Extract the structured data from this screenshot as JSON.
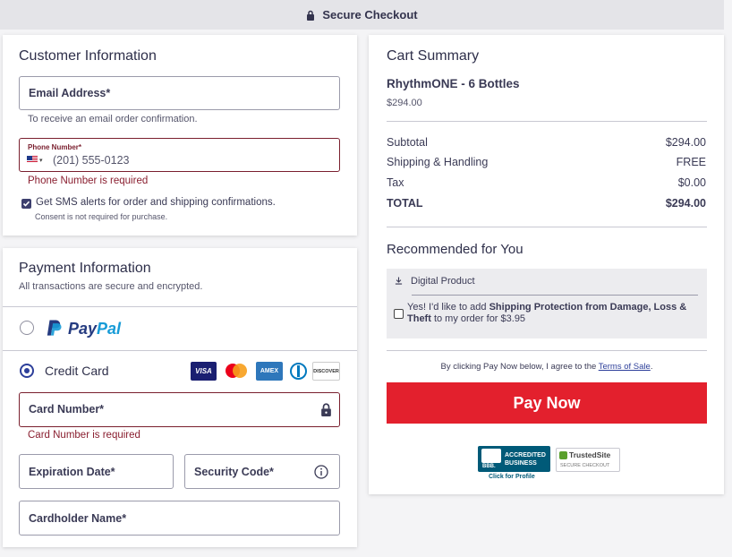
{
  "topbar": {
    "title": "Secure Checkout"
  },
  "customer": {
    "title": "Customer Information",
    "email": {
      "label": "Email Address*",
      "hint": "To receive an email order confirmation."
    },
    "phone": {
      "label": "Phone Number*",
      "placeholder": "(201) 555-0123",
      "country_flag": "us-flag-icon",
      "error": "Phone Number is required"
    },
    "sms": {
      "label": "Get SMS alerts for order and shipping confirmations.",
      "subtext": "Consent is not required for purchase.",
      "checked": true
    }
  },
  "payment": {
    "title": "Payment Information",
    "subtitle": "All transactions are secure and encrypted.",
    "paypal": {
      "label_pay": "Pay",
      "label_pal": "Pal"
    },
    "credit": {
      "label": "Credit Card",
      "logos": [
        "VISA",
        "mastercard",
        "AMEX",
        "diners",
        "DISCOVER"
      ]
    },
    "card_number": {
      "label": "Card Number*",
      "error": "Card Number is required"
    },
    "expiration": {
      "label": "Expiration Date*"
    },
    "security": {
      "label": "Security Code*"
    },
    "cardholder": {
      "label": "Cardholder Name*"
    }
  },
  "cart": {
    "title": "Cart Summary",
    "product": {
      "name": "RhythmONE - 6 Bottles",
      "price": "$294.00"
    },
    "rows": [
      {
        "label": "Subtotal",
        "value": "$294.00"
      },
      {
        "label": "Shipping & Handling",
        "value": "FREE"
      },
      {
        "label": "Tax",
        "value": "$0.00"
      },
      {
        "label": "TOTAL",
        "value": "$294.00"
      }
    ],
    "recommended": {
      "title": "Recommended for You",
      "tag": "Digital Product",
      "offer_prefix": "Yes! I'd like to add ",
      "offer_bold": "Shipping Protection from Damage, Loss & Theft",
      "offer_suffix": " to my order for $3.95"
    },
    "terms_prefix": "By clicking Pay Now below, I agree to the ",
    "terms_link": "Terms of Sale",
    "terms_suffix": ".",
    "pay_button": "Pay Now",
    "badges": {
      "bbb_line1": "ACCREDITED",
      "bbb_line2": "BUSINESS",
      "bbb_mark": "BBB.",
      "bbb_caption": "Click for Profile",
      "trusted_title": "TrustedSite",
      "trusted_sub": "SECURE CHECKOUT"
    }
  },
  "colors": {
    "accent": "#e3202d",
    "error": "#8a1f30",
    "primary": "#2d3f9a",
    "paypal_dark": "#253b80",
    "paypal_light": "#179bd7"
  }
}
